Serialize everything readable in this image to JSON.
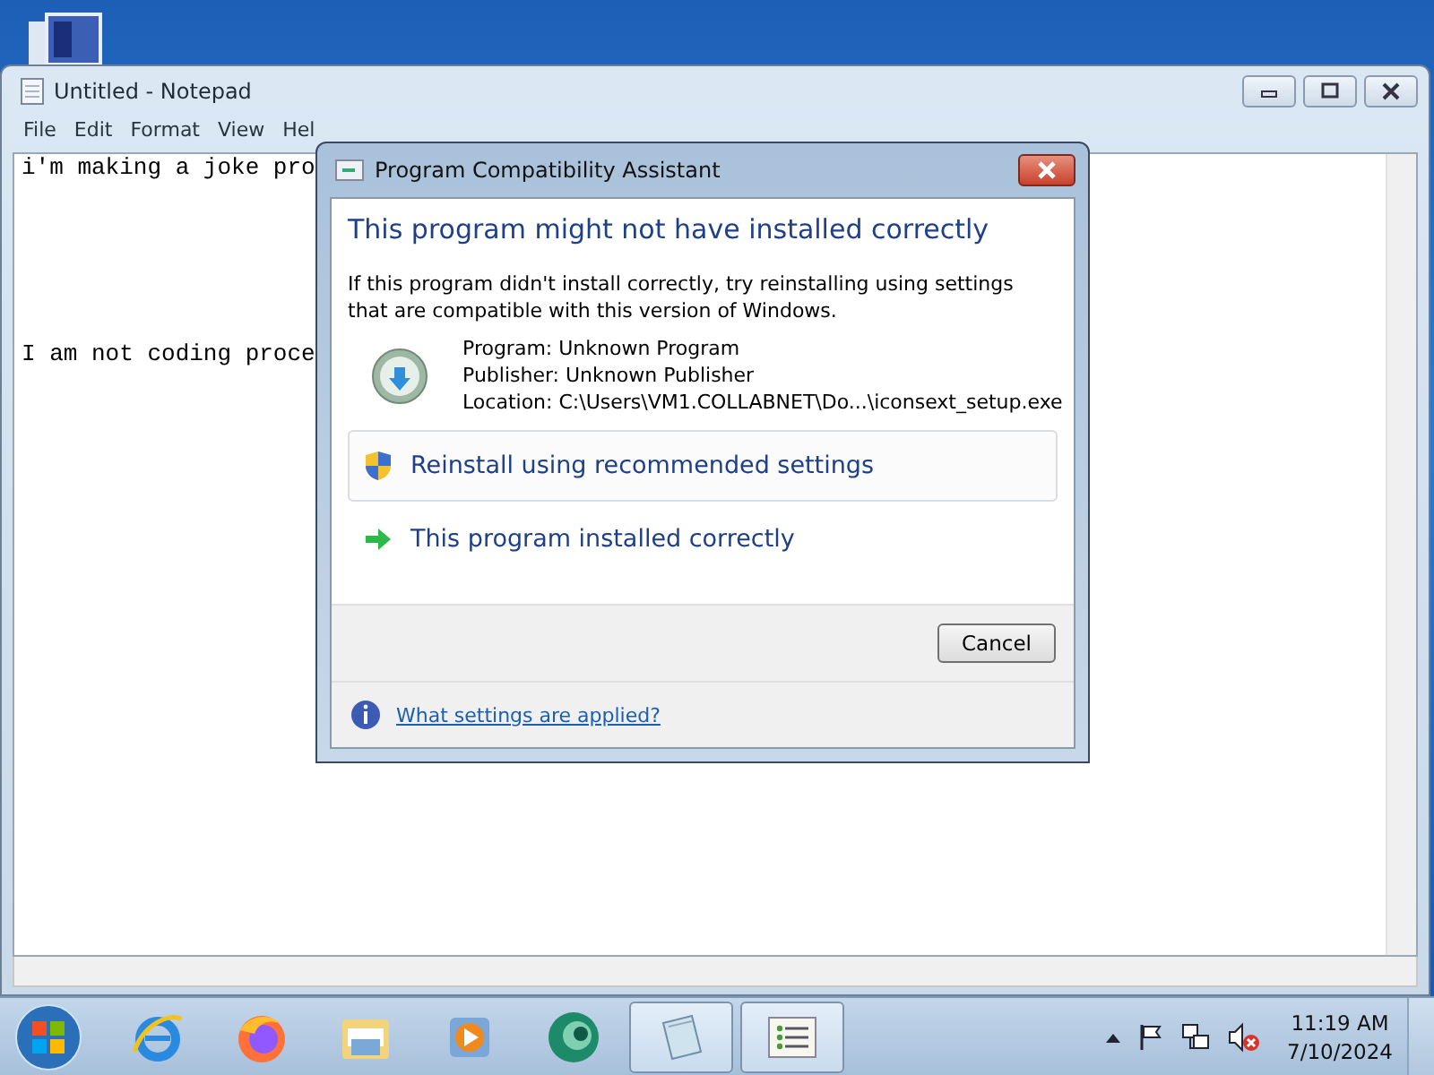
{
  "notepad": {
    "title": "Untitled - Notepad",
    "menu": [
      "File",
      "Edit",
      "Format",
      "View",
      "Hel"
    ],
    "lines": [
      "i'm making a joke pro",
      "I am not coding proce"
    ]
  },
  "dialog": {
    "title": "Program Compatibility Assistant",
    "heading": "This program might not have installed correctly",
    "message": "If this program didn't install correctly, try reinstalling using settings that are compatible with this version of Windows.",
    "details": [
      "Program: Unknown Program",
      "Publisher: Unknown Publisher",
      "Location: C:\\Users\\VM1.COLLABNET\\Do...\\iconsext_setup.exe"
    ],
    "options": [
      {
        "kind": "shield",
        "label": "Reinstall using recommended settings",
        "selected": true
      },
      {
        "kind": "arrow",
        "label": "This program installed correctly",
        "selected": false
      }
    ],
    "cancel": "Cancel",
    "help_link": "What settings are applied?"
  },
  "taskbar": {
    "items": [
      {
        "kind": "browser",
        "open": false
      },
      {
        "kind": "fox",
        "open": false
      },
      {
        "kind": "folder",
        "open": false
      },
      {
        "kind": "media",
        "open": false
      },
      {
        "kind": "disc",
        "open": false
      },
      {
        "kind": "notepad",
        "open": true
      },
      {
        "kind": "list",
        "open": true
      }
    ],
    "time": "11:19 AM",
    "date": "7/10/2024"
  }
}
